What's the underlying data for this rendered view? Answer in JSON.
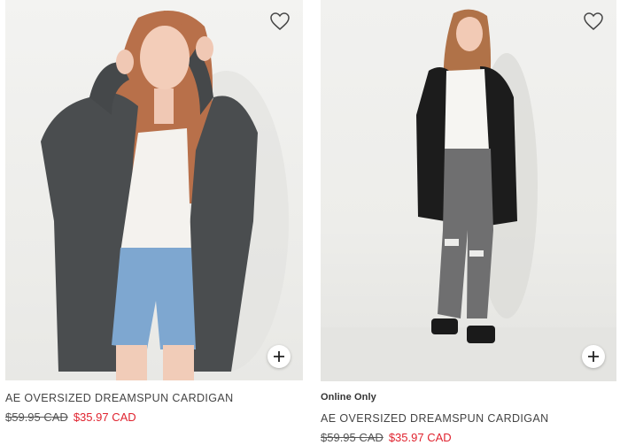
{
  "products": [
    {
      "badge": "",
      "name": "AE OVERSIZED DREAMSPUN CARDIGAN",
      "original_price": "$59.95 CAD",
      "sale_price": "$35.97 CAD",
      "icons": {
        "favorite": "heart-outline-icon",
        "quick_add": "plus-icon"
      }
    },
    {
      "badge": "Online Only",
      "name": "AE OVERSIZED DREAMSPUN CARDIGAN",
      "original_price": "$59.95 CAD",
      "sale_price": "$35.97 CAD",
      "icons": {
        "favorite": "heart-outline-icon",
        "quick_add": "plus-icon"
      }
    }
  ],
  "colors": {
    "sale": "#e0232f",
    "text": "#333333"
  }
}
